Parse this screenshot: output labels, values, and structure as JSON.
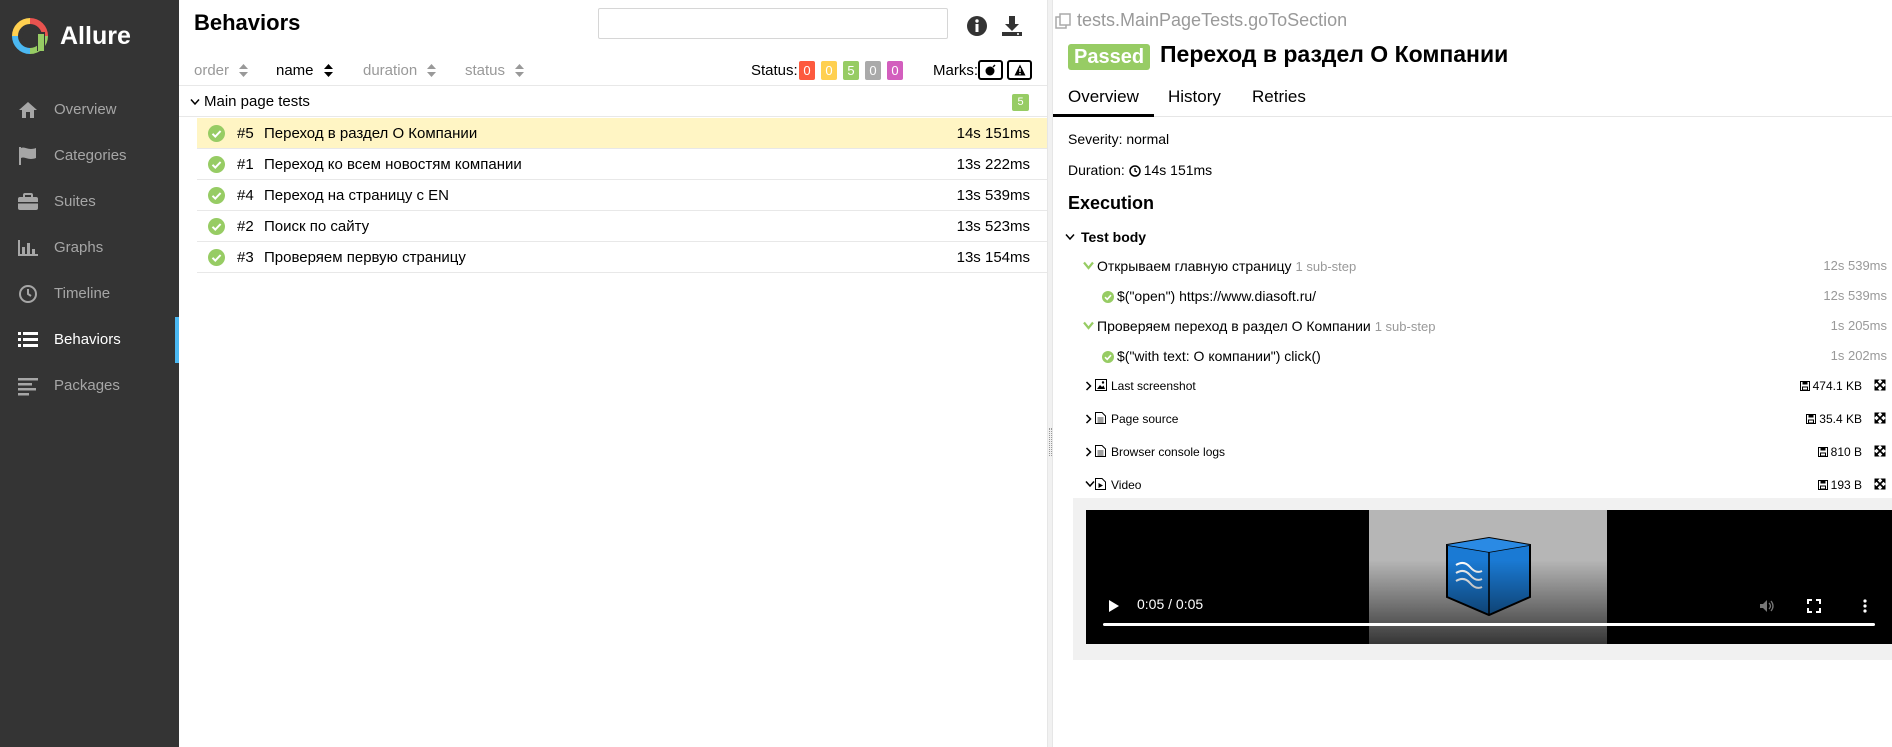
{
  "app": {
    "name": "Allure"
  },
  "sidebar": {
    "items": [
      {
        "label": "Overview",
        "icon": "home-icon"
      },
      {
        "label": "Categories",
        "icon": "flag-icon"
      },
      {
        "label": "Suites",
        "icon": "briefcase-icon"
      },
      {
        "label": "Graphs",
        "icon": "bar-chart-icon"
      },
      {
        "label": "Timeline",
        "icon": "clock-icon"
      },
      {
        "label": "Behaviors",
        "icon": "list-icon",
        "active": true
      },
      {
        "label": "Packages",
        "icon": "align-left-icon"
      }
    ]
  },
  "behaviors": {
    "title": "Behaviors",
    "search": {
      "value": "",
      "placeholder": ""
    },
    "sort": {
      "order": "order",
      "name": "name",
      "duration": "duration",
      "status": "status"
    },
    "status_label": "Status:",
    "counters": [
      {
        "value": "0",
        "color": "#fd5a3e",
        "status": "failed"
      },
      {
        "value": "0",
        "color": "#ffd050",
        "status": "broken"
      },
      {
        "value": "5",
        "color": "#97cc64",
        "status": "passed"
      },
      {
        "value": "0",
        "color": "#aaaaaa",
        "status": "skipped"
      },
      {
        "value": "0",
        "color": "#d35ebe",
        "status": "unknown"
      }
    ],
    "marks_label": "Marks:",
    "group": {
      "title": "Main page tests",
      "count": "5"
    },
    "rows": [
      {
        "num": "#5",
        "name": "Переход в раздел О Компании",
        "duration": "14s 151ms",
        "selected": true
      },
      {
        "num": "#1",
        "name": "Переход ко всем новостям компании",
        "duration": "13s 222ms"
      },
      {
        "num": "#4",
        "name": "Переход на страницу с EN",
        "duration": "13s 539ms"
      },
      {
        "num": "#2",
        "name": "Поиск по сайту",
        "duration": "13s 523ms"
      },
      {
        "num": "#3",
        "name": "Проверяем первую страницу",
        "duration": "13s 154ms"
      }
    ]
  },
  "testcase": {
    "full_name": "tests.MainPageTests.goToSection",
    "status": "Passed",
    "title": "Переход в раздел О Компании",
    "tabs": [
      "Overview",
      "History",
      "Retries"
    ],
    "severity": "Severity: normal",
    "duration_label": "Duration:",
    "duration": "14s 151ms",
    "execution_title": "Execution",
    "test_body": "Test body",
    "steps": [
      {
        "name": "Открываем главную страницу",
        "sub": "1 sub-step",
        "duration": "12s 539ms"
      },
      {
        "name": "$(\"open\") https://www.diasoft.ru/",
        "duration": "12s 539ms"
      },
      {
        "name": "Проверяем переход в раздел О Компании",
        "sub": "1 sub-step",
        "duration": "1s 205ms"
      },
      {
        "name": "$(\"with text: О компании\") click()",
        "duration": "1s 202ms"
      }
    ],
    "attachments": [
      {
        "name": "Last screenshot",
        "size": "474.1 KB",
        "icon": "image-icon"
      },
      {
        "name": "Page source",
        "size": "35.4 KB",
        "icon": "file-icon"
      },
      {
        "name": "Browser console logs",
        "size": "810 B",
        "icon": "file-icon"
      },
      {
        "name": "Video",
        "size": "193 B",
        "icon": "video-file-icon",
        "expanded": true
      }
    ],
    "video": {
      "time": "0:05 / 0:05",
      "progress": 1.0
    }
  }
}
